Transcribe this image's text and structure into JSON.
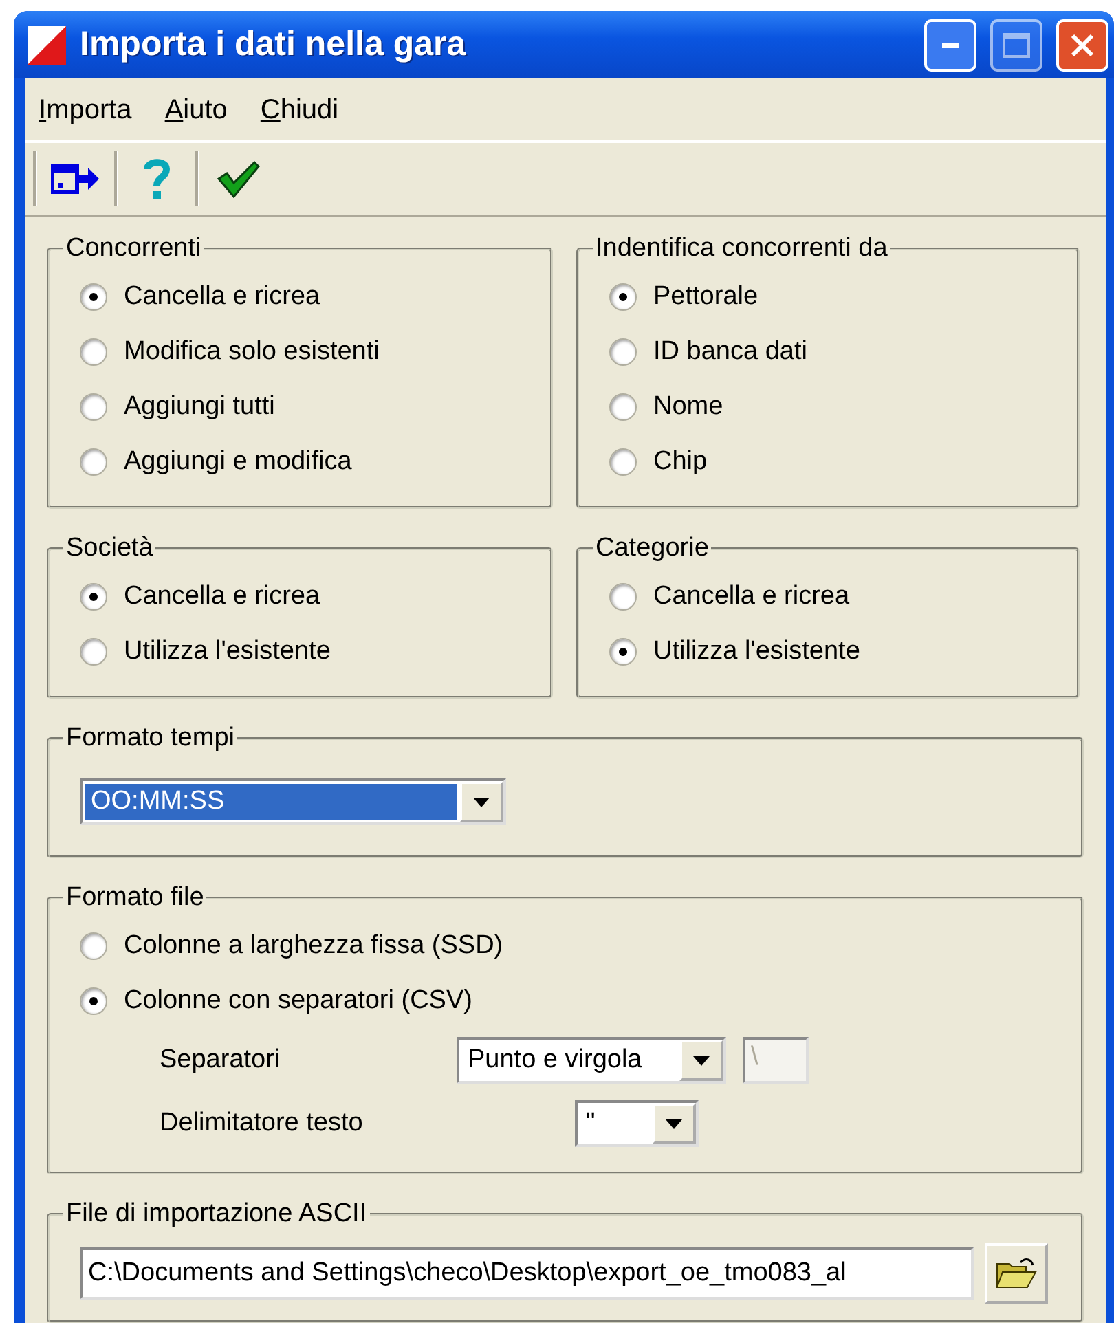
{
  "window": {
    "title": "Importa i dati nella gara"
  },
  "menu": [
    {
      "label": "Importa"
    },
    {
      "label": "Aiuto"
    },
    {
      "label": "Chiudi"
    }
  ],
  "top_groups": [
    {
      "title": "Concorrenti",
      "options": [
        {
          "label": "Cancella e ricrea",
          "selected": true
        },
        {
          "label": "Modifica solo esistenti",
          "selected": false
        },
        {
          "label": "Aggiungi tutti",
          "selected": false
        },
        {
          "label": "Aggiungi e modifica",
          "selected": false
        }
      ]
    },
    {
      "title": "Indentifica concorrenti da",
      "options": [
        {
          "label": "Pettorale",
          "selected": true
        },
        {
          "label": "ID banca dati",
          "selected": false
        },
        {
          "label": "Nome",
          "selected": false
        },
        {
          "label": "Chip",
          "selected": false
        }
      ]
    },
    {
      "title": "Società",
      "options": [
        {
          "label": "Cancella e ricrea",
          "selected": true
        },
        {
          "label": "Utilizza l'esistente",
          "selected": false
        }
      ]
    },
    {
      "title": "Categorie",
      "options": [
        {
          "label": "Cancella e ricrea",
          "selected": false
        },
        {
          "label": "Utilizza l'esistente",
          "selected": true
        }
      ]
    }
  ],
  "formato_tempi": {
    "title": "Formato tempi",
    "value": "OO:MM:SS",
    "highlighted": true
  },
  "formato_file": {
    "title": "Formato file",
    "options": [
      {
        "label": "Colonne a larghezza fissa (SSD)",
        "selected": false
      },
      {
        "label": "Colonne con separatori (CSV)",
        "selected": true
      }
    ],
    "separatori": {
      "label": "Separatori",
      "value": "Punto e virgola",
      "extra": "\\",
      "extra_disabled": true
    },
    "delimitatore": {
      "label": "Delimitatore testo",
      "value": "\""
    }
  },
  "file_ascii": {
    "title": "File di importazione ASCII",
    "path": "C:\\Documents and Settings\\checo\\Desktop\\export_oe_tmo083_al"
  }
}
